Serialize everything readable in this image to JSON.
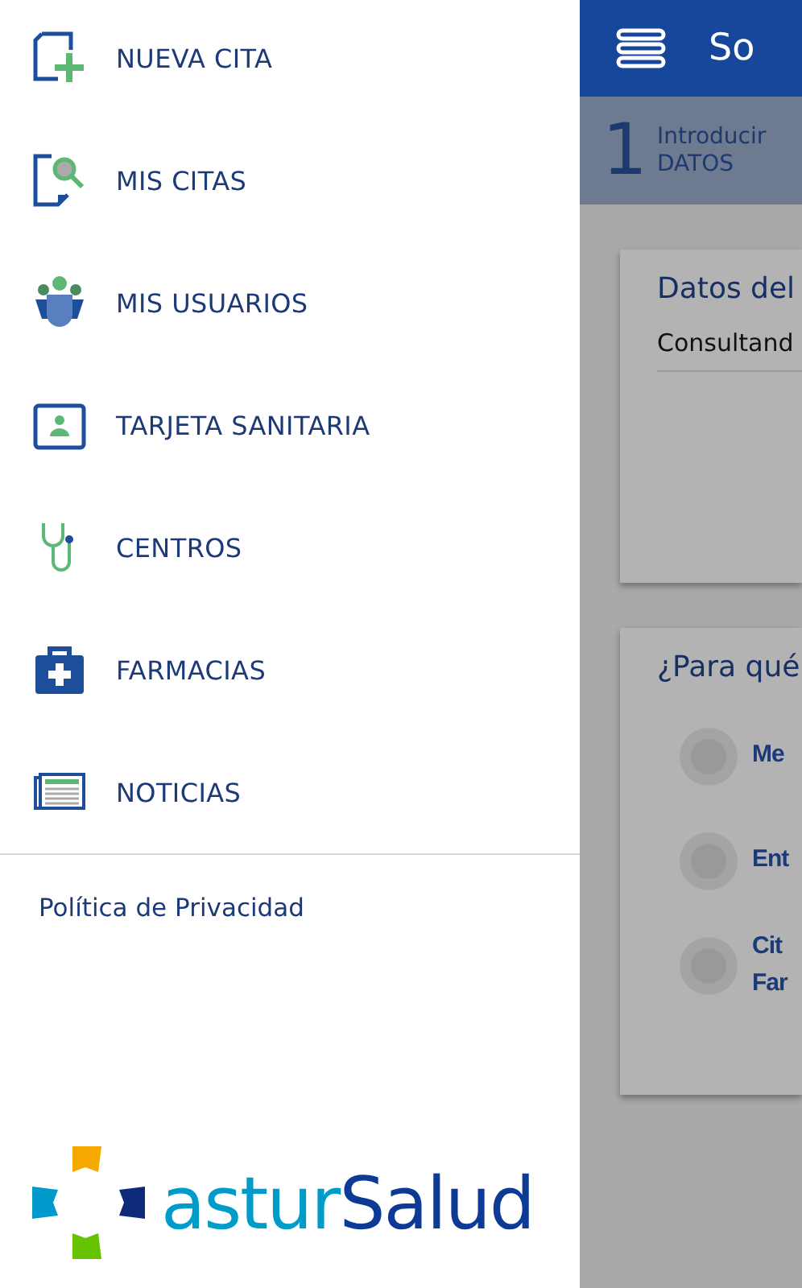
{
  "drawer": {
    "items": [
      {
        "kind": "new",
        "label": "NUEVA CITA"
      },
      {
        "kind": "search",
        "label": "MIS CITAS"
      },
      {
        "kind": "users",
        "label": "MIS USUARIOS"
      },
      {
        "kind": "card",
        "label": "TARJETA SANITARIA"
      },
      {
        "kind": "stethoscope",
        "label": "CENTROS"
      },
      {
        "kind": "kit",
        "label": "FARMACIAS"
      },
      {
        "kind": "news",
        "label": "NOTICIAS"
      }
    ],
    "privacy_link": "Política de Privacidad",
    "logo": {
      "part_1": "astur",
      "part_2": "Salud"
    }
  },
  "app": {
    "title": "So",
    "step": {
      "number": "1",
      "line_1": "Introducir",
      "line_2": "DATOS"
    },
    "card_1": {
      "title": "Datos del",
      "text": "Consultand"
    },
    "card_2": {
      "title": "¿Para qué",
      "options": [
        {
          "label": "Me",
          "selected": false
        },
        {
          "label": "Ent",
          "selected": false
        },
        {
          "label": "Cit Far",
          "selected": false
        }
      ]
    }
  }
}
